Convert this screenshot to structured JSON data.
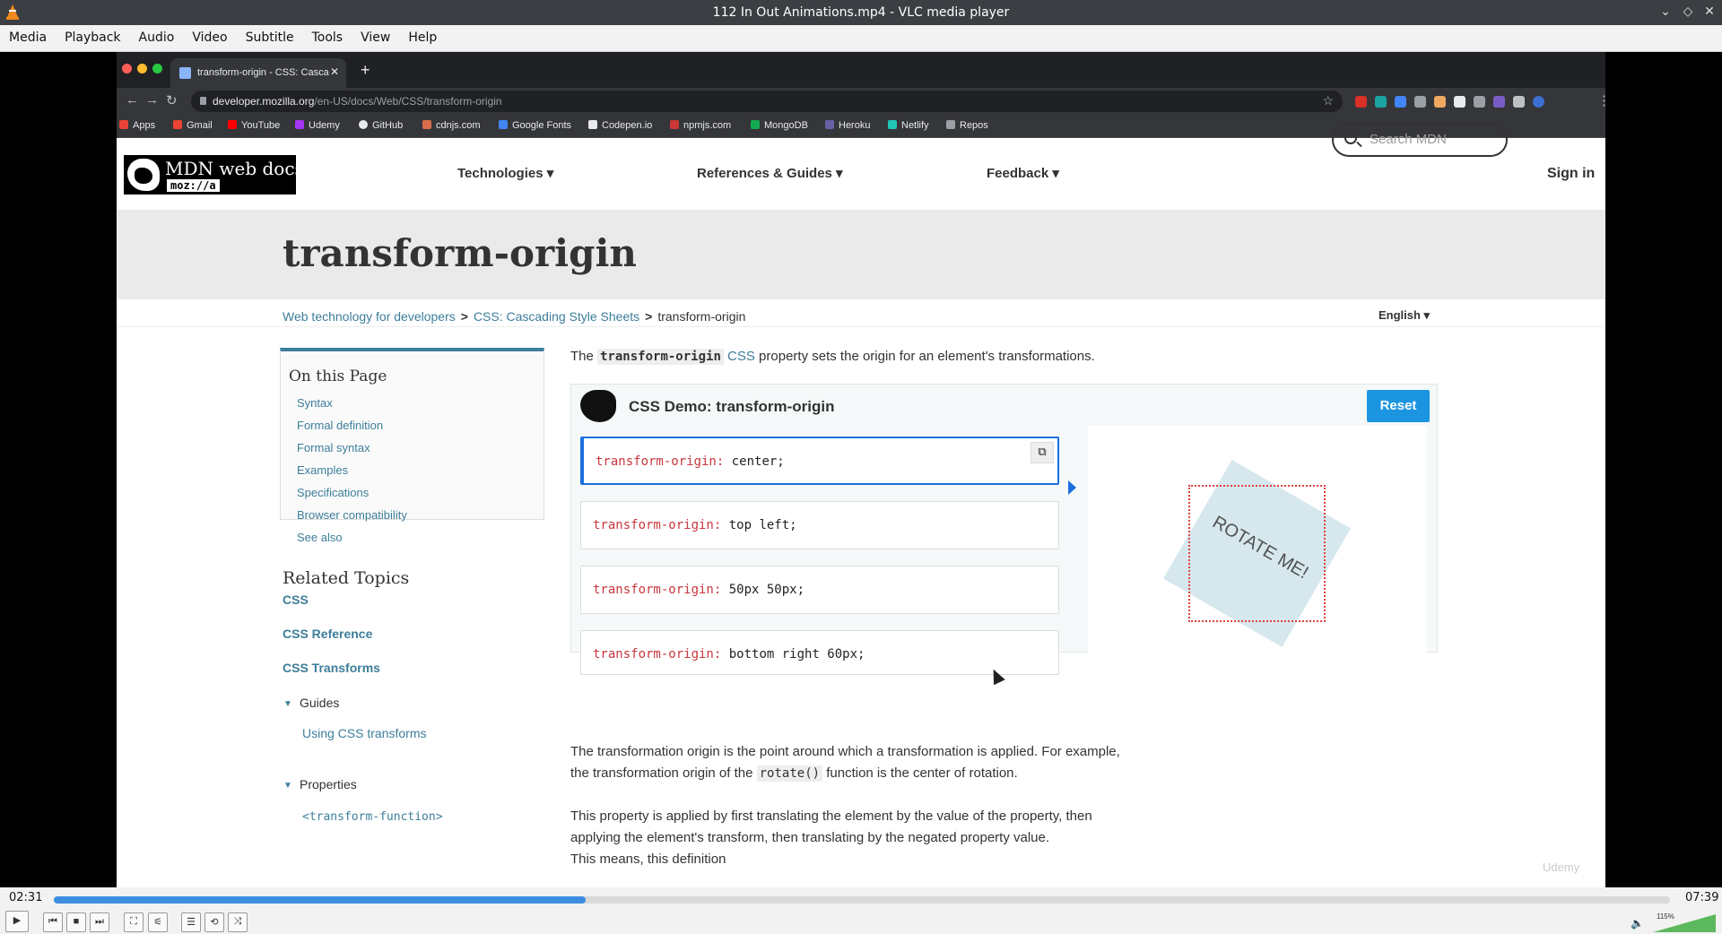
{
  "window": {
    "title": "112 In Out Animations.mp4 - VLC media player",
    "controls": [
      "⌄",
      "◇",
      "✕"
    ]
  },
  "menu": [
    "Media",
    "Playback",
    "Audio",
    "Video",
    "Subtitle",
    "Tools",
    "View",
    "Help"
  ],
  "browser": {
    "tab_title": "transform-origin - CSS: Casca",
    "tab_close": "✕",
    "new_tab": "+",
    "url_host": "developer.mozilla.org",
    "url_path": "/en-US/docs/Web/CSS/transform-origin",
    "bookmarks": [
      "Apps",
      "Gmail",
      "YouTube",
      "Udemy",
      "GitHub",
      "cdnjs.com",
      "Google Fonts",
      "Codepen.io",
      "npmjs.com",
      "MongoDB",
      "Heroku",
      "Netlify",
      "Repos"
    ]
  },
  "mdn": {
    "logo_text": "MDN web docs",
    "logo_sub": "moz://a",
    "nav": [
      "Technologies ▾",
      "References & Guides ▾",
      "Feedback ▾"
    ],
    "search_placeholder": "Search MDN",
    "sign_in": "Sign in",
    "page_title": "transform-origin",
    "breadcrumbs": [
      "Web technology for developers",
      "CSS: Cascading Style Sheets",
      "transform-origin"
    ],
    "breadcrumb_sep": ">",
    "language": "English ▾",
    "toc": {
      "title": "On this Page",
      "items": [
        "Syntax",
        "Formal definition",
        "Formal syntax",
        "Examples",
        "Specifications",
        "Browser compatibility",
        "See also"
      ]
    },
    "related": {
      "title": "Related Topics",
      "links": [
        "CSS",
        "CSS Reference",
        "CSS Transforms"
      ],
      "guides_label": "Guides",
      "guides_items": [
        "Using CSS transforms"
      ],
      "properties_label": "Properties",
      "properties_items": [
        "<transform-function>"
      ],
      "toggle": "▼"
    },
    "intro": {
      "pre": "The ",
      "code": "transform-origin",
      "link": "CSS",
      "post": " property sets the origin for an element's transformations."
    },
    "demo": {
      "title": "CSS Demo: transform-origin",
      "reset": "Reset",
      "copy_icon": "⧉",
      "property": "transform-origin:",
      "options": [
        " center;",
        " top left;",
        " 50px 50px;",
        " bottom right 60px;"
      ],
      "selected_index": 0,
      "rotate_label": "ROTATE ME!"
    },
    "para1_line1": "The transformation origin is the point around which a transformation is applied. For example,",
    "para1_pre": "the transformation origin of the ",
    "para1_code": "rotate()",
    "para1_post": " function is the center of rotation.",
    "para2_line1": "This property is applied by first translating the element by the value of the property, then",
    "para2_line2": "applying the element's transform, then translating by the negated property value.",
    "para2_line3": "This means, this definition",
    "watermark": "Udemy"
  },
  "player": {
    "elapsed": "02:31",
    "total": "07:39",
    "progress": 0.329,
    "volume_pct": "115%",
    "buttons": [
      "▶",
      "⏮",
      "■",
      "⏭",
      "⛶",
      "⚟",
      "☰",
      "⟲",
      "⤨"
    ]
  }
}
